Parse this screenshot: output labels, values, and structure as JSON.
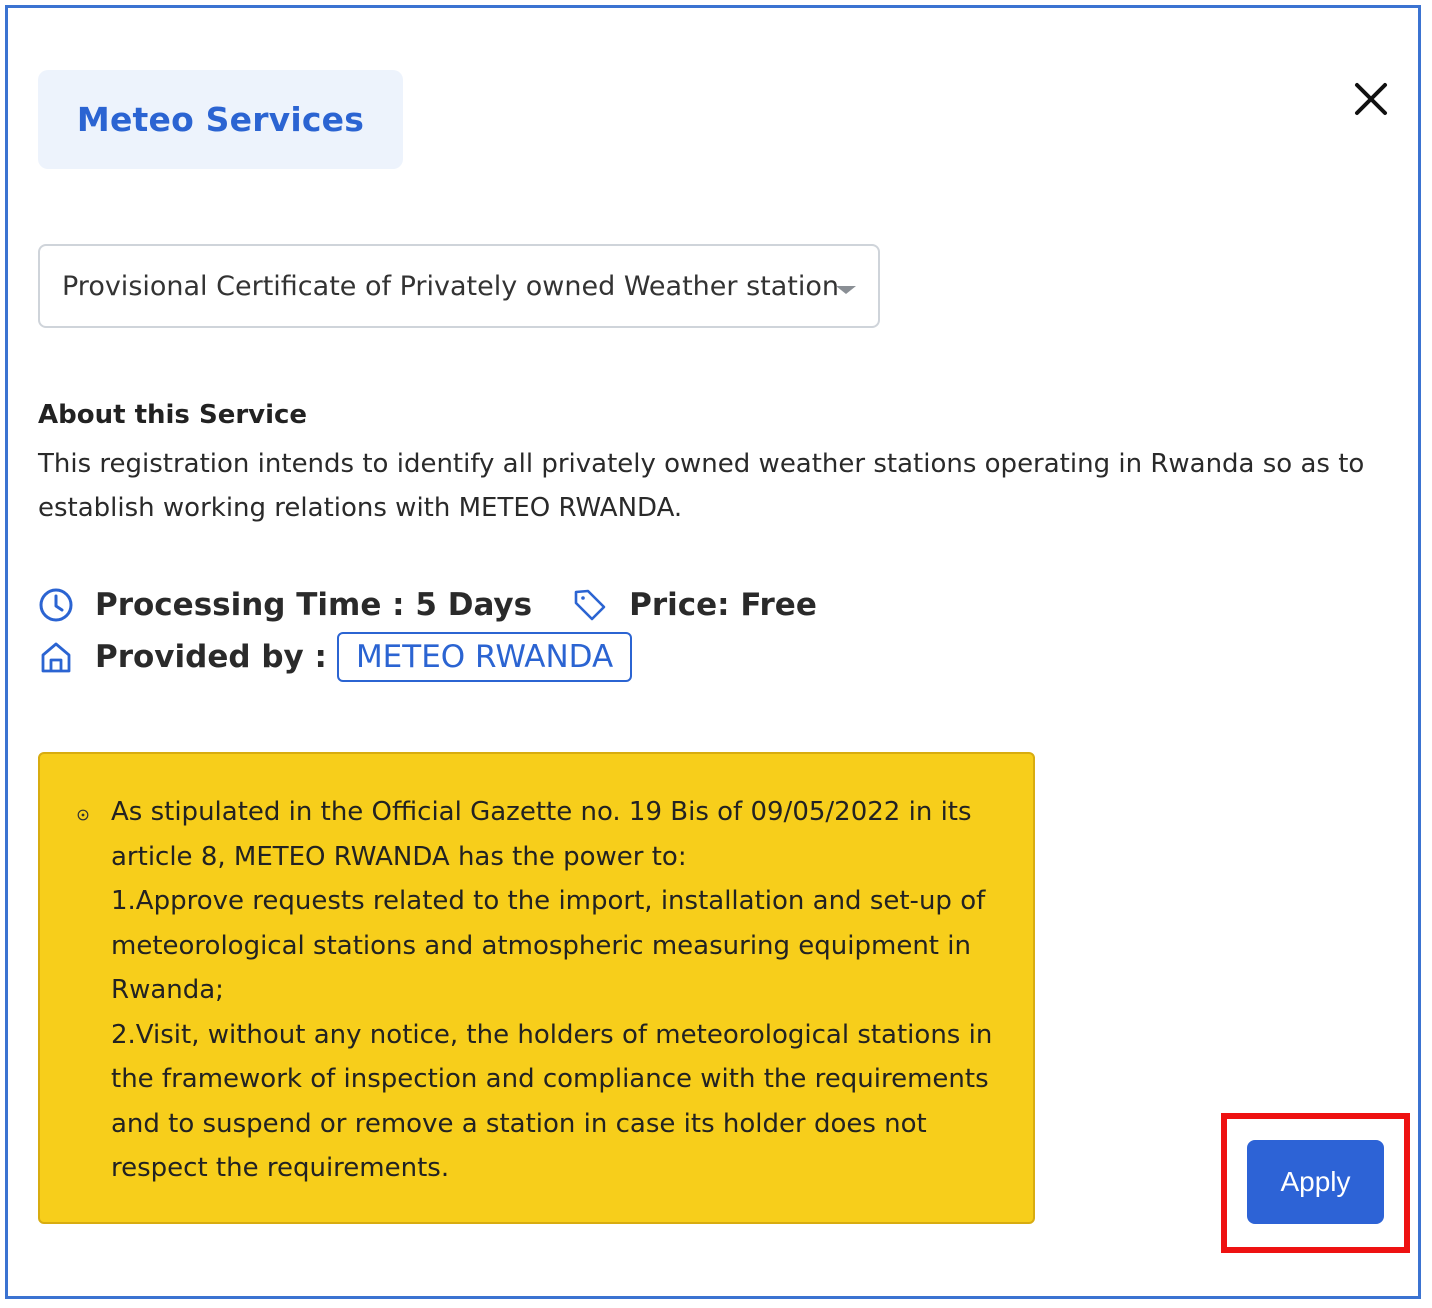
{
  "header": {
    "service_category": "Meteo Services",
    "close_icon": "close-icon"
  },
  "service_select": {
    "selected": "Provisional Certificate of Privately owned Weather station",
    "caret_icon": "caret-down-icon"
  },
  "about": {
    "title": "About this Service",
    "description": "This registration intends to identify all privately owned weather stations operating in Rwanda so as to establish working relations with METEO RWANDA."
  },
  "meta": {
    "processing_icon": "clock-icon",
    "processing_time": "Processing Time : 5 Days",
    "price_icon": "tag-icon",
    "price": "Price: Free",
    "provider_icon": "home-icon",
    "provided_by_label": "Provided by :",
    "provider_name": "METEO RWANDA"
  },
  "notice": {
    "bullet_icon": "info-circle-icon",
    "lines": [
      "As stipulated in the Official Gazette no. 19 Bis of 09/05/2022 in its article 8, METEO RWANDA has the power to:",
      "1.Approve requests related to the import, installation and set-up of meteorological stations and atmospheric measuring equipment in Rwanda;",
      "2.Visit, without any notice, the holders of meteorological stations in the framework of inspection and compliance with the requirements and to suspend or remove a station in case its holder does not respect the requirements."
    ]
  },
  "actions": {
    "apply_label": "Apply"
  },
  "colors": {
    "accent": "#2d63d6",
    "chip_background": "#edf3fc",
    "notice_background": "#f7ce1b",
    "highlight": "#ee1111"
  }
}
